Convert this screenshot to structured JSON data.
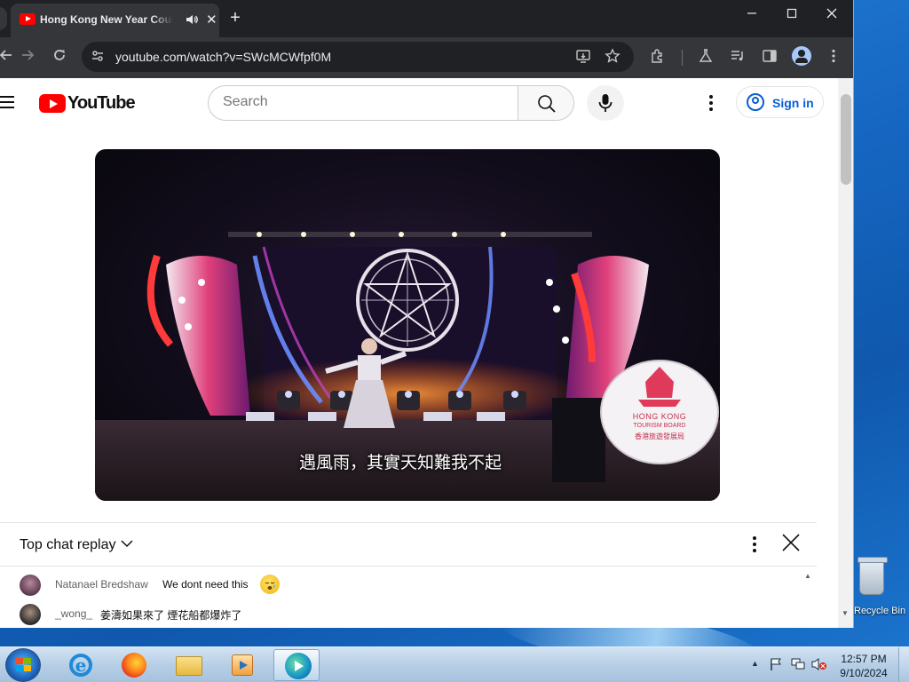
{
  "browser": {
    "tab": {
      "title": "Hong Kong New Year Countdown",
      "sound_icon": "speaker-icon",
      "close_glyph": "✕"
    },
    "new_tab_glyph": "+",
    "window_controls": {
      "minimize": "—",
      "maximize": "☐",
      "close": "✕"
    },
    "url": "youtube.com/watch?v=SWcMCWfpf0M"
  },
  "youtube": {
    "logo_text": "YouTube",
    "search_placeholder": "Search",
    "sign_in": "Sign in",
    "brand_color": "#ff0000",
    "link_color": "#065fd4"
  },
  "video": {
    "subtitle": "遇風雨，其實天知難我不起",
    "board_line1": "HONG KONG",
    "board_line2": "TOURISM BOARD",
    "board_line3": "香港旅遊發展局"
  },
  "chat": {
    "mode_label": "Top chat replay",
    "messages": [
      {
        "author": "Natanael Bredshaw",
        "text": "We dont need this"
      },
      {
        "author": "_wong_",
        "text": "姜濤如果來了 煙花船都爆炸了"
      }
    ]
  },
  "desktop": {
    "recycle_bin_label": "Recycle Bin"
  },
  "taskbar": {
    "time": "12:57 PM",
    "date": "9/10/2024"
  }
}
